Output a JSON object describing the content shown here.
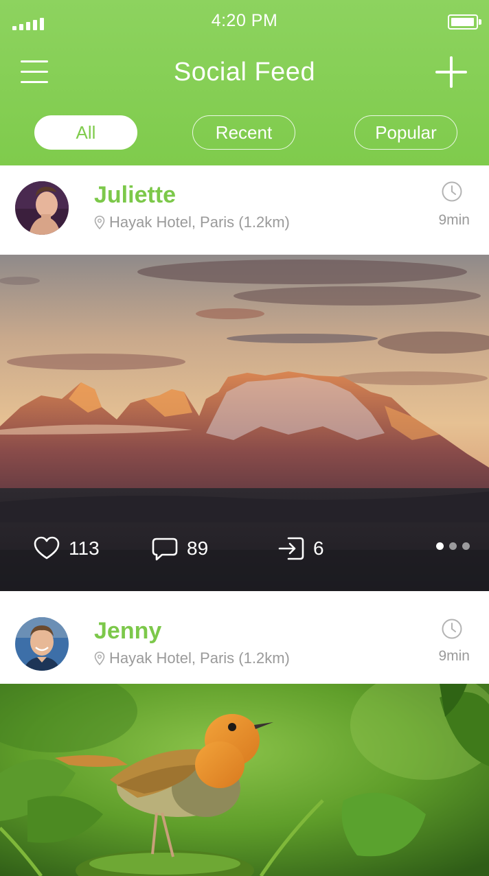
{
  "status_bar": {
    "time": "4:20 PM",
    "signal_bars": 5,
    "battery_level": 0.9
  },
  "nav": {
    "title": "Social Feed",
    "menu_icon": "hamburger-menu-icon",
    "add_icon": "plus-icon"
  },
  "tabs": [
    {
      "label": "All",
      "active": true
    },
    {
      "label": "Recent",
      "active": false
    },
    {
      "label": "Popular",
      "active": false
    }
  ],
  "posts": [
    {
      "author": "Juliette",
      "location": "Hayak Hotel, Paris (1.2km)",
      "time_ago": "9min",
      "image": "mountain-sunset-photo",
      "likes": "113",
      "comments": "89",
      "shares": "6",
      "pager_dots": 3
    },
    {
      "author": "Jenny",
      "location": "Hayak Hotel, Paris (1.2km)",
      "time_ago": "9min",
      "image": "robin-bird-photo"
    }
  ],
  "colors": {
    "accent": "#7fcb4c",
    "muted_text": "#9a9a9a",
    "background": "#ffffff"
  }
}
